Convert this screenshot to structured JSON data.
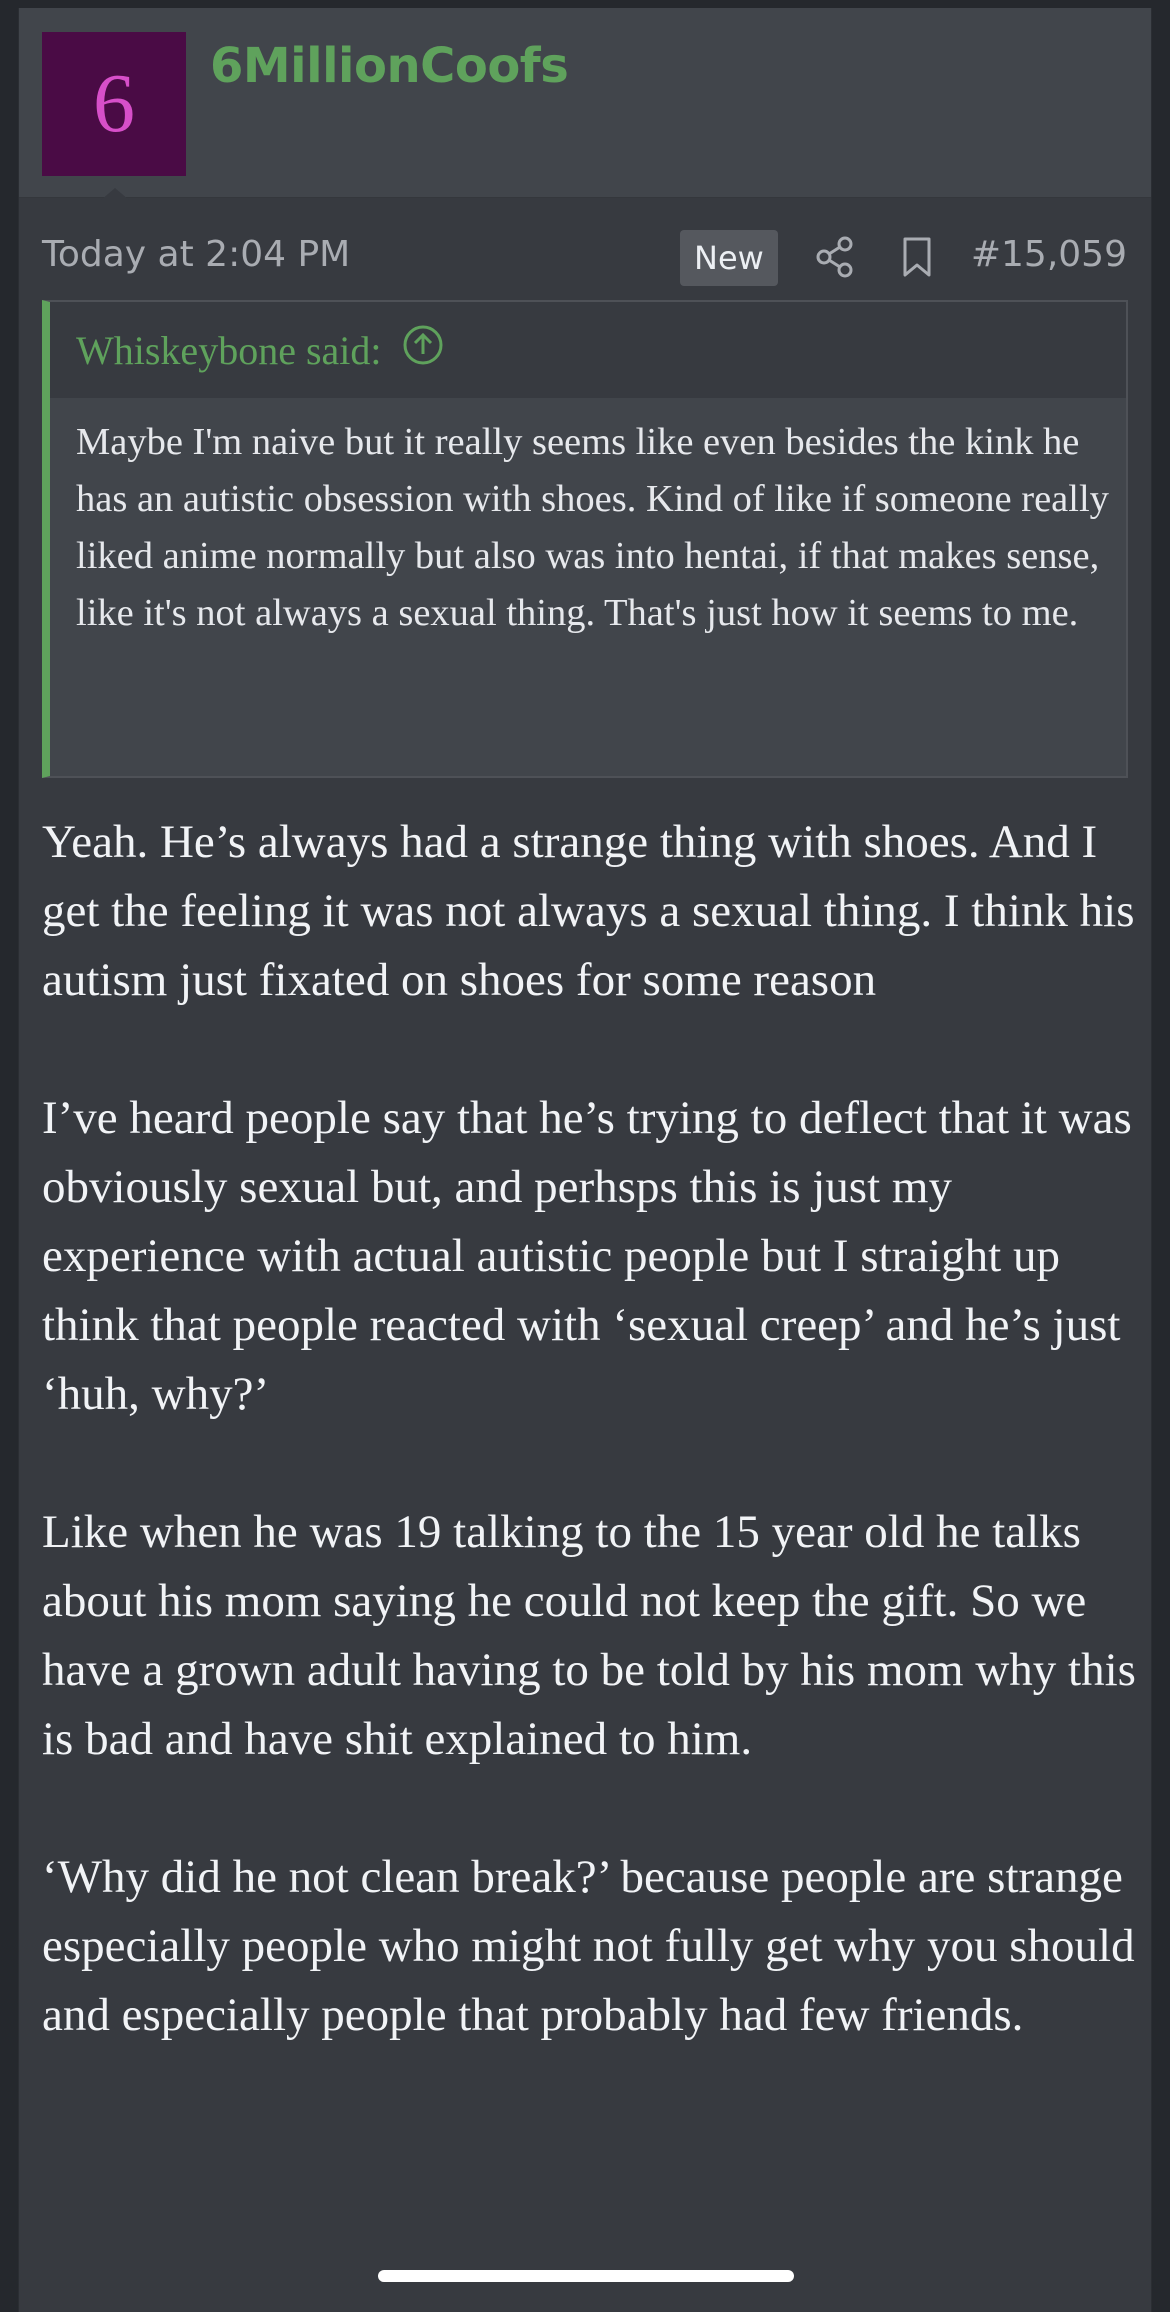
{
  "user": {
    "avatar_letter": "6",
    "avatar_bg": "#4a0b45",
    "avatar_fg": "#d74fc9",
    "username": "6MillionCoofs",
    "username_color": "#5fa25c"
  },
  "meta": {
    "timestamp": "Today at 2:04 PM",
    "new_badge": "New",
    "share_icon": "share-icon",
    "bookmark_icon": "bookmark-icon",
    "post_number": "#15,059"
  },
  "quote": {
    "author": "Whiskeybone said:",
    "jump_icon": "arrow-up-circle-icon",
    "text": "Maybe I'm naive but it really seems like even besides the kink he has an autistic obsession with shoes. Kind of like if someone really liked anime normally but also was into hentai, if that makes sense, like it's not always a sexual thing. That's just how it seems to me."
  },
  "message": {
    "paragraphs": [
      "Yeah. He’s always had a strange thing with shoes. And I get the feeling it was not always a sexual thing. I think his autism just fixated on shoes for some reason",
      "I’ve heard people say that he’s trying to deflect that it was obviously sexual but, and perhsps this is just my experience with actual autistic people but I straight up think that people reacted with ‘sexual creep’ and he’s just ‘huh, why?’",
      "Like when he was 19 talking to the 15 year old he talks about his mom saying he could not keep the gift. So we have a grown adult having to be told by his mom why this is bad and have shit explained to him.",
      "‘Why did he not clean break?’ because people are strange especially people who might not fully get why you should and especially people that probably had few friends."
    ]
  },
  "colors": {
    "background": "#25282d",
    "post_bg": "#373a40",
    "header_bg": "#41454b",
    "accent_green": "#5fa25c"
  }
}
